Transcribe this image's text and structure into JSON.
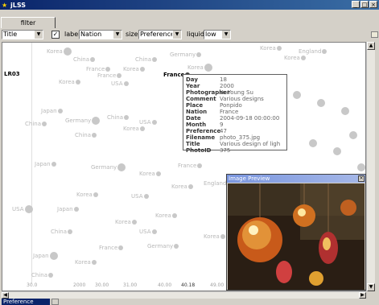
{
  "window": {
    "title": "jLSS",
    "minimize": "_",
    "maximize": "□",
    "close": "×"
  },
  "tab": {
    "label": "filter"
  },
  "toolbar": {
    "title_combo": "Title",
    "label_label": "label",
    "label_value": "Nation",
    "size_label": "size",
    "size_value": "Preference",
    "liquid_label": "liquid",
    "liquid_value": "low",
    "checkbox_mark": "✓"
  },
  "plot": {
    "marker_label": "LR03",
    "xticks": [
      "30.0",
      "2000",
      "30.00",
      "31.00",
      "40.00",
      "49.00",
      "50.00",
      "60.00"
    ],
    "selected_tick": "40.18",
    "points": [
      {
        "t": "Korea"
      },
      {
        "t": "China"
      },
      {
        "t": "China"
      },
      {
        "t": "Germany"
      },
      {
        "t": "Korea"
      },
      {
        "t": "France"
      },
      {
        "t": "Korea"
      },
      {
        "t": "Korea"
      },
      {
        "t": "Korea"
      },
      {
        "t": "England"
      },
      {
        "t": "France"
      },
      {
        "t": "USA"
      },
      {
        "t": "Korea"
      },
      {
        "t": "Japan"
      },
      {
        "t": "Germany"
      },
      {
        "t": "China"
      },
      {
        "t": "China"
      },
      {
        "t": "China"
      },
      {
        "t": "Korea"
      },
      {
        "t": "USA"
      },
      {
        "t": "Japan"
      },
      {
        "t": "Germany"
      },
      {
        "t": "Korea"
      },
      {
        "t": "France"
      },
      {
        "t": "Korea"
      },
      {
        "t": "Japan"
      },
      {
        "t": "USA"
      },
      {
        "t": "Korea"
      },
      {
        "t": "USA"
      },
      {
        "t": "England"
      },
      {
        "t": "Korea"
      },
      {
        "t": "China"
      },
      {
        "t": "Korea"
      },
      {
        "t": "USA"
      },
      {
        "t": "France"
      },
      {
        "t": "Japan"
      },
      {
        "t": "Korea"
      },
      {
        "t": "Germany"
      },
      {
        "t": "Korea"
      },
      {
        "t": "China"
      }
    ],
    "selected_point": "France"
  },
  "tooltip": {
    "rows": [
      {
        "k": "Day",
        "v": "18"
      },
      {
        "k": "Year",
        "v": "2000"
      },
      {
        "k": "Photographer",
        "v": "Yo Young Su"
      },
      {
        "k": "Comment",
        "v": "Various designs"
      },
      {
        "k": "Place",
        "v": "Ponpido"
      },
      {
        "k": "Nation",
        "v": "France"
      },
      {
        "k": "Date",
        "v": "2004-09-18 00:00:00"
      },
      {
        "k": "Month",
        "v": "9"
      },
      {
        "k": "Preference",
        "v": "47"
      },
      {
        "k": "Filename",
        "v": "photo_375.jpg"
      },
      {
        "k": "Title",
        "v": "Various design of ligh"
      },
      {
        "k": "PhotoID",
        "v": "375"
      }
    ]
  },
  "preview": {
    "title": "Image Preview",
    "close": "×"
  },
  "bottom": {
    "combo_value": "Preference"
  },
  "colors": {
    "titlebar": "#0a246a",
    "selected": "#404040",
    "point": "#c8c8c8"
  }
}
